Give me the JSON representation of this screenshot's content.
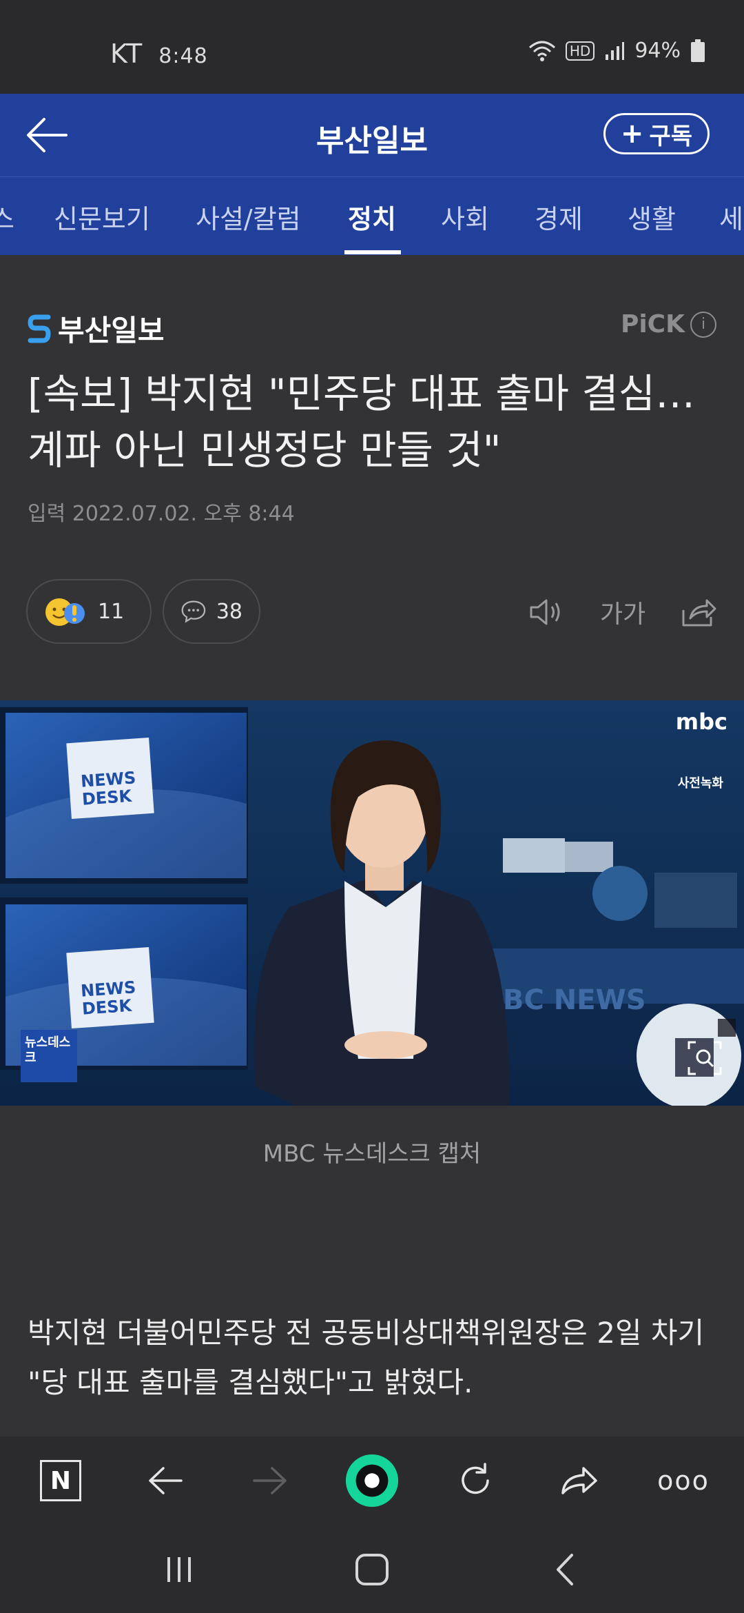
{
  "status_bar": {
    "carrier": "KT",
    "time": "8:48",
    "hd_label": "HD",
    "battery": "94%"
  },
  "header": {
    "title": "부산일보",
    "subscribe_label": "구독",
    "subscribe_plus": "+"
  },
  "tabs": [
    {
      "label": "스"
    },
    {
      "label": "신문보기"
    },
    {
      "label": "사설/칼럼"
    },
    {
      "label": "정치",
      "active": true
    },
    {
      "label": "사회"
    },
    {
      "label": "경제"
    },
    {
      "label": "생활"
    },
    {
      "label": "세"
    }
  ],
  "article": {
    "publisher": "부산일보",
    "pick_label": "PiCK",
    "pick_info": "i",
    "headline": "[속보] 박지현 \"민주당 대표 출마 결심…계파 아닌 민생정당 만들 것\"",
    "date_label": "입력",
    "date": "2022.07.02. 오후 8:44",
    "reaction_count": "11",
    "comment_count": "38",
    "font_size_label": "가가",
    "photo_caption": "MBC 뉴스데스크 캡처",
    "body": "박지현 더불어민주당 전 공동비상대책위원장은 2일 차기 \"당 대표 출마를 결심했다\"고 밝혔다."
  },
  "photo_overlay": {
    "broadcaster": "mbc",
    "recorded_badge": "사전녹화",
    "screen_label_1": "NEWS",
    "screen_label_2": "DESK",
    "corner_logo": "뉴스데스크",
    "wall_text": "BC NEWS"
  },
  "browser_bar": {
    "n_label": "N",
    "more_label": "ooo"
  },
  "colors": {
    "brand_blue": "#21409b",
    "background": "#333335",
    "accent_green": "#16d59a"
  }
}
